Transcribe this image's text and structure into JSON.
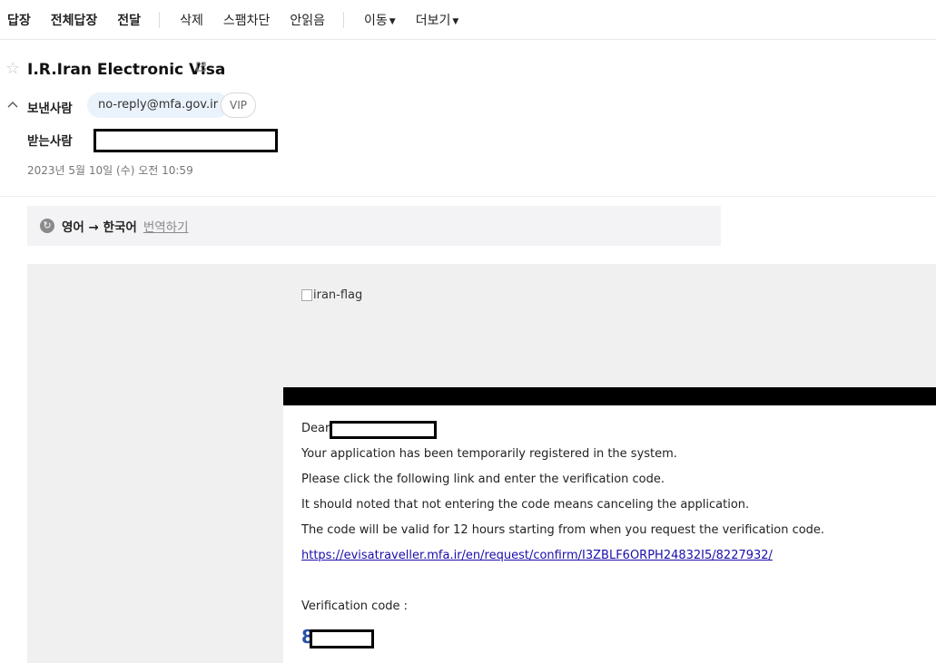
{
  "toolbar": {
    "reply": "답장",
    "reply_all": "전체답장",
    "forward": "전달",
    "delete": "삭제",
    "spam_block": "스팸차단",
    "unread": "안읽음",
    "move": "이동",
    "more": "더보기"
  },
  "header": {
    "subject": "I.R.Iran Electronic Visa",
    "sender_label": "보낸사람",
    "sender_email": "no-reply@mfa.gov.ir",
    "vip_label": "VIP",
    "recipient_label": "받는사람",
    "date": "2023년 5월 10일 (수) 오전 10:59"
  },
  "translate": {
    "languages": "영어 → 한국어",
    "action": "번역하기"
  },
  "body": {
    "flag_alt": "iran-flag",
    "greeting": "Dear",
    "line1": "Your application has been temporarily registered in the system.",
    "line2": "Please click the following link and enter the verification code.",
    "line3": "It should noted that not entering the code means canceling the application.",
    "line4": "The code will be valid for 12 hours starting from when you request the verification code.",
    "link": "https://evisatraveller.mfa.ir/en/request/confirm/I3ZBLF6ORPH24832I5/8227932/",
    "code_label": "Verification code :",
    "code_first_digit": "8"
  },
  "icons": {
    "star": "star-outline-icon",
    "external": "external-link-icon",
    "collapse": "chevron-up-icon",
    "translate": "translate-icon",
    "caret": "caret-down-icon"
  }
}
